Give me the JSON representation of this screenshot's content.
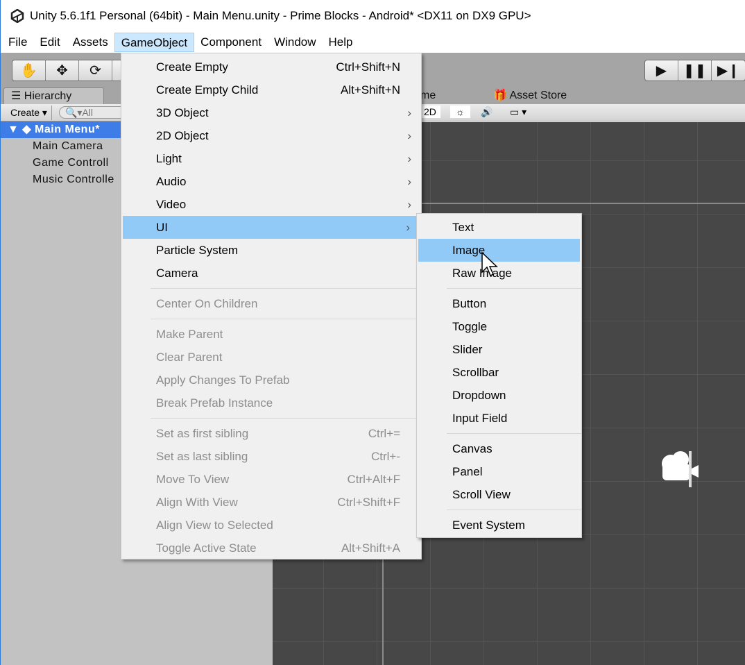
{
  "title": "Unity 5.6.1f1 Personal (64bit) - Main Menu.unity - Prime Blocks - Android* <DX11 on DX9 GPU>",
  "menubar": [
    "File",
    "Edit",
    "Assets",
    "GameObject",
    "Component",
    "Window",
    "Help"
  ],
  "tabs": {
    "hierarchy": "Hierarchy",
    "game": "me",
    "asset_store": "Asset Store"
  },
  "hierarchy": {
    "create": "Create",
    "search_placeholder": "All",
    "scene": "Main Menu*",
    "items": [
      "Main Camera",
      "Game Controll",
      "Music Controlle"
    ]
  },
  "scene_toolbar": {
    "mode": "2D"
  },
  "gameobject_menu": {
    "groups": [
      [
        {
          "label": "Create Empty",
          "shortcut": "Ctrl+Shift+N"
        },
        {
          "label": "Create Empty Child",
          "shortcut": "Alt+Shift+N"
        },
        {
          "label": "3D Object",
          "submenu": true
        },
        {
          "label": "2D Object",
          "submenu": true
        },
        {
          "label": "Light",
          "submenu": true
        },
        {
          "label": "Audio",
          "submenu": true
        },
        {
          "label": "Video",
          "submenu": true
        },
        {
          "label": "UI",
          "submenu": true,
          "highlighted": true
        },
        {
          "label": "Particle System"
        },
        {
          "label": "Camera"
        }
      ],
      [
        {
          "label": "Center On Children",
          "disabled": true
        }
      ],
      [
        {
          "label": "Make Parent",
          "disabled": true
        },
        {
          "label": "Clear Parent",
          "disabled": true
        },
        {
          "label": "Apply Changes To Prefab",
          "disabled": true
        },
        {
          "label": "Break Prefab Instance",
          "disabled": true
        }
      ],
      [
        {
          "label": "Set as first sibling",
          "shortcut": "Ctrl+=",
          "disabled": true
        },
        {
          "label": "Set as last sibling",
          "shortcut": "Ctrl+-",
          "disabled": true
        },
        {
          "label": "Move To View",
          "shortcut": "Ctrl+Alt+F",
          "disabled": true
        },
        {
          "label": "Align With View",
          "shortcut": "Ctrl+Shift+F",
          "disabled": true
        },
        {
          "label": "Align View to Selected",
          "disabled": true
        },
        {
          "label": "Toggle Active State",
          "shortcut": "Alt+Shift+A",
          "disabled": true
        }
      ]
    ]
  },
  "ui_submenu": {
    "groups": [
      [
        {
          "label": "Text"
        },
        {
          "label": "Image",
          "highlighted": true
        },
        {
          "label": "Raw Image"
        }
      ],
      [
        {
          "label": "Button"
        },
        {
          "label": "Toggle"
        },
        {
          "label": "Slider"
        },
        {
          "label": "Scrollbar"
        },
        {
          "label": "Dropdown"
        },
        {
          "label": "Input Field"
        }
      ],
      [
        {
          "label": "Canvas"
        },
        {
          "label": "Panel"
        },
        {
          "label": "Scroll View"
        }
      ],
      [
        {
          "label": "Event System"
        }
      ]
    ]
  },
  "colors": {
    "highlight": "#91c9f7",
    "selection": "#3e7de7",
    "scene_bg": "#474747"
  }
}
